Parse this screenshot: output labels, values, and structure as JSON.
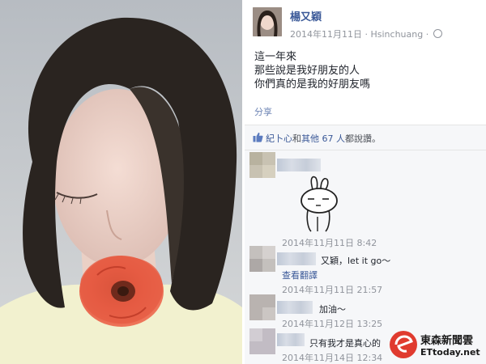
{
  "post": {
    "poster_name": "楊又穎",
    "date": "2014年11月11日",
    "location": "Hsinchuang",
    "lines": [
      "這一年來",
      "那些說是我好朋友的人",
      "你們真的是我的好朋友嗎"
    ],
    "share_label": "分享"
  },
  "likes": {
    "names": "紀卜心",
    "connector": "和",
    "others_label": "其他 67 人",
    "suffix": "都說讚。"
  },
  "comments": [
    {
      "text": "",
      "time": "2014年11月11日 8:42"
    },
    {
      "text": "又穎，let it go～",
      "translate": "查看翻譯",
      "time": "2014年11月11日 21:57"
    },
    {
      "text": "加油～",
      "time": "2014年11月12日 13:25"
    },
    {
      "text": "只有我才是真心的",
      "time": "2014年11月14日 12:34"
    }
  ],
  "watermark": {
    "line1": "東森新聞雲",
    "line2": "ETtoday.net"
  },
  "colors": {
    "link": "#3b5998",
    "meta": "#90949c",
    "comment_bg": "#f6f7f9",
    "flower": "#e2553f"
  }
}
